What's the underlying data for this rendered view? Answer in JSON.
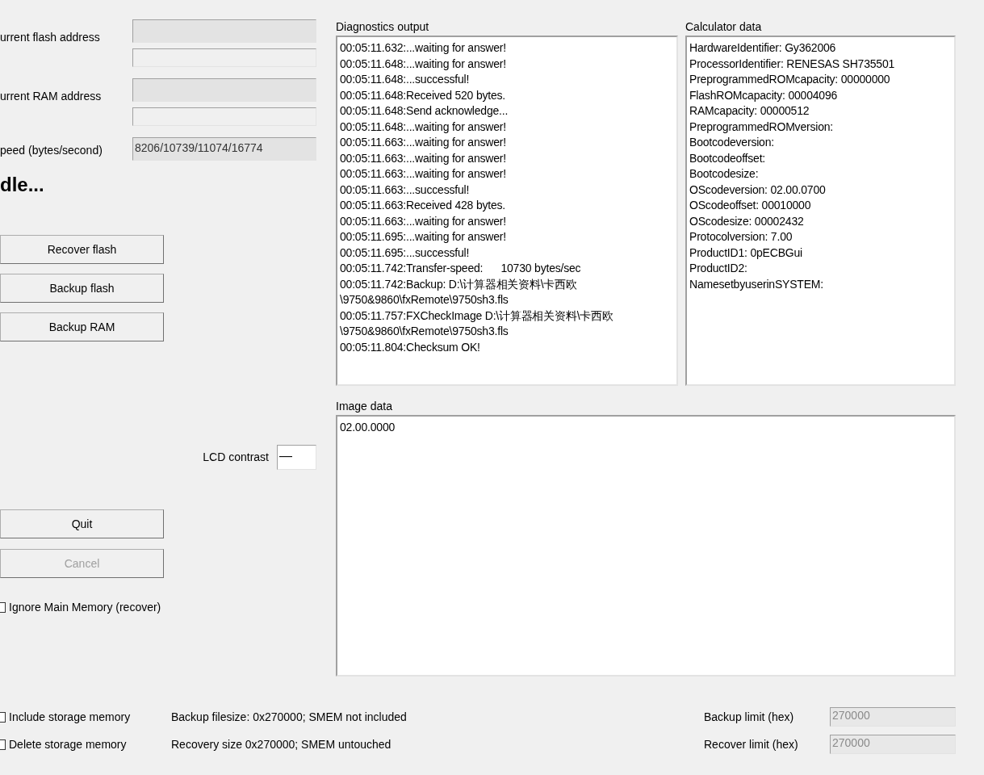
{
  "left": {
    "fields": [
      {
        "label": "urrent flash address",
        "kind": "pair"
      },
      {
        "label": "urrent RAM address",
        "kind": "pair"
      },
      {
        "label": "peed (bytes/second)",
        "value": "8206/10739/11074/16774",
        "kind": "single"
      }
    ],
    "status": "dle...",
    "actions": [
      {
        "label": "Recover flash",
        "disabled": false
      },
      {
        "label": "Backup flash",
        "disabled": false
      },
      {
        "label": "Backup RAM",
        "disabled": false
      }
    ],
    "lcd_contrast": {
      "label": "LCD contrast",
      "value": "—"
    },
    "controls": [
      {
        "label": "Quit",
        "disabled": false
      },
      {
        "label": "Cancel",
        "disabled": true
      }
    ],
    "ignore_main_memory": {
      "label": "Ignore Main Memory (recover)",
      "checked": false
    }
  },
  "diagnostics": {
    "title": "Diagnostics output",
    "lines": [
      "00:05:11.632:...waiting for answer!",
      "00:05:11.648:...waiting for answer!",
      "00:05:11.648:...successful!",
      "00:05:11.648:Received 520 bytes.",
      "00:05:11.648:Send acknowledge...",
      "00:05:11.648:...waiting for answer!",
      "00:05:11.663:...waiting for answer!",
      "00:05:11.663:...waiting for answer!",
      "00:05:11.663:...waiting for answer!",
      "00:05:11.663:...successful!",
      "00:05:11.663:Received 428 bytes.",
      "00:05:11.663:...waiting for answer!",
      "00:05:11.695:...waiting for answer!",
      "00:05:11.695:...successful!",
      "00:05:11.742:Transfer-speed:      10730 bytes/sec",
      "00:05:11.742:Backup: D:\\计算器相关资料\\卡西欧\\9750&9860\\fxRemote\\9750sh3.fls",
      "00:05:11.757:FXCheckImage D:\\计算器相关资料\\卡西欧\\9750&9860\\fxRemote\\9750sh3.fls",
      "00:05:11.804:Checksum OK!"
    ]
  },
  "calculator": {
    "title": "Calculator data",
    "lines": [
      "HardwareIdentifier: Gy362006",
      "ProcessorIdentifier: RENESAS SH735501",
      "PreprogrammedROMcapacity: 00000000",
      "FlashROMcapacity: 00004096",
      "RAMcapacity: 00000512",
      "PreprogrammedROMversion:",
      "Bootcodeversion:",
      "Bootcodeoffset:",
      "Bootcodesize:",
      "OScodeversion: 02.00.0700",
      "OScodeoffset: 00010000",
      "OScodesize: 00002432",
      "Protocolversion: 7.00",
      "ProductID1: 0pECBGui",
      "ProductID2:",
      "NamesetbyuserinSYSTEM:"
    ]
  },
  "image_data": {
    "title": "Image data",
    "lines": [
      "02.00.0000"
    ]
  },
  "storage": [
    {
      "label": "Include storage memory",
      "checked": false,
      "info": "Backup filesize: 0x270000; SMEM not included",
      "limit_label": "Backup limit (hex)",
      "limit_value": "270000",
      "disabled": true
    },
    {
      "label": "Delete storage memory",
      "checked": false,
      "info": "Recovery size 0x270000; SMEM untouched",
      "limit_label": "Recover limit (hex)",
      "limit_value": "270000",
      "disabled": true
    }
  ]
}
